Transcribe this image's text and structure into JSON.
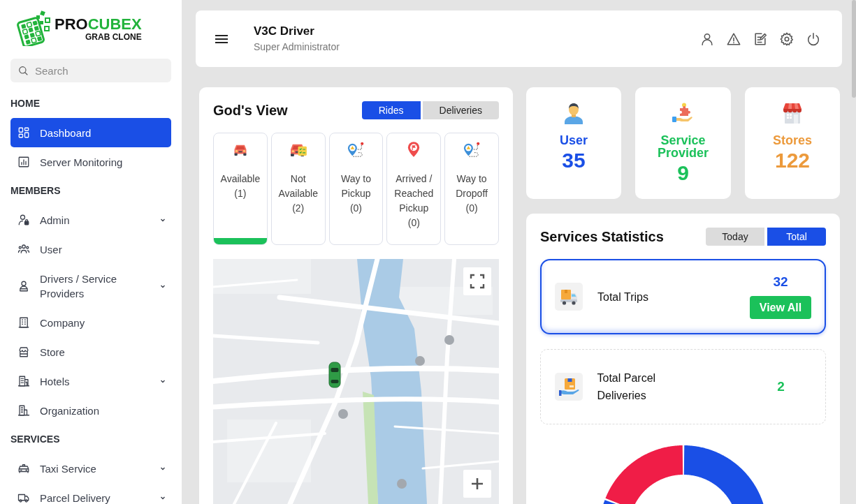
{
  "sidebar": {
    "brand": [
      "PRO",
      "CUBEX"
    ],
    "tagline": "GRAB CLONE",
    "search": {
      "placeholder": "Search"
    },
    "sections": [
      {
        "title": "HOME",
        "items": [
          {
            "label": "Dashboard",
            "selected": true,
            "submenu": false
          },
          {
            "label": "Server Monitoring",
            "selected": false,
            "submenu": false
          }
        ]
      },
      {
        "title": "MEMBERS",
        "items": [
          {
            "label": "Admin",
            "selected": false,
            "submenu": true
          },
          {
            "label": "User",
            "selected": false,
            "submenu": false
          },
          {
            "label": "Drivers / Service Providers",
            "selected": false,
            "submenu": true
          },
          {
            "label": "Company",
            "selected": false,
            "submenu": false
          },
          {
            "label": "Store",
            "selected": false,
            "submenu": false
          },
          {
            "label": "Hotels",
            "selected": false,
            "submenu": true
          },
          {
            "label": "Organization",
            "selected": false,
            "submenu": false
          }
        ]
      },
      {
        "title": "SERVICES",
        "items": [
          {
            "label": "Taxi Service",
            "selected": false,
            "submenu": true
          },
          {
            "label": "Parcel Delivery",
            "selected": false,
            "submenu": true
          }
        ]
      }
    ]
  },
  "header": {
    "title": "V3C Driver",
    "subtitle": "Super Administrator"
  },
  "gods_view": {
    "title": "God's View",
    "tabs": [
      {
        "label": "Rides",
        "selected": true
      },
      {
        "label": "Deliveries",
        "selected": false
      }
    ],
    "statuses": [
      {
        "label": "Available",
        "count": "(1)",
        "selected": true
      },
      {
        "label": "Not Available",
        "count": "(2)",
        "selected": false
      },
      {
        "label": "Way to Pickup",
        "count": "(0)",
        "selected": false
      },
      {
        "label": "Arrived / Reached Pickup",
        "count": "(0)",
        "selected": false
      },
      {
        "label": "Way to Dropoff",
        "count": "(0)",
        "selected": false
      }
    ]
  },
  "stat_cards": [
    {
      "label": "User",
      "value": "35",
      "color": "#1a4fe6"
    },
    {
      "label": "Service Provider",
      "value": "9",
      "color": "#1bc15a"
    },
    {
      "label": "Stores",
      "value": "122",
      "color": "#ec9a3c"
    }
  ],
  "services_statistics": {
    "title": "Services Statistics",
    "tabs": [
      {
        "label": "Today",
        "selected": false
      },
      {
        "label": "Total",
        "selected": true
      }
    ],
    "items": [
      {
        "label": "Total Trips",
        "value": "32",
        "color": "#1a4fe6",
        "selected": true,
        "button": "View All"
      },
      {
        "label": "Total Parcel Deliveries",
        "value": "2",
        "color": "#1bc15a",
        "selected": false
      }
    ]
  }
}
